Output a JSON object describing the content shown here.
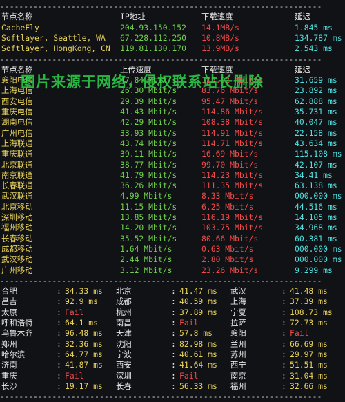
{
  "divider": "--------------------------------------------------------------------",
  "cdn_table": {
    "headers": [
      "节点名称",
      "IP地址",
      "下载速度",
      "延迟"
    ],
    "rows": [
      {
        "name": "CacheFly",
        "ip": "204.93.150.152",
        "speed": "14.1MB/s",
        "latency": "1.845 ms"
      },
      {
        "name": "Softlayer, Seattle, WA",
        "ip": "67.228.112.250",
        "speed": "10.8MB/s",
        "latency": "134.787 ms"
      },
      {
        "name": "Softlayer, HongKong, CN",
        "ip": "119.81.130.170",
        "speed": "13.9MB/s",
        "latency": "2.543 ms"
      }
    ]
  },
  "watermark": "图片来源于网络，侵权联系站长删除",
  "isp_table": {
    "headers": [
      "节点名称",
      "上传速度",
      "下载速度",
      "延迟"
    ],
    "rows": [
      {
        "name": "襄阳电信",
        "up": "47.84 Mbit/s",
        "down": "115.02 Mbit/s",
        "latency": "31.659 ms"
      },
      {
        "name": "上海电信",
        "up": "26.30 Mbit/s",
        "down": "83.76 Mbit/s",
        "latency": "23.892 ms"
      },
      {
        "name": "西安电信",
        "up": "29.39 Mbit/s",
        "down": "95.47 Mbit/s",
        "latency": "62.888 ms"
      },
      {
        "name": "重庆电信",
        "up": "41.43 Mbit/s",
        "down": "114.86 Mbit/s",
        "latency": "35.731 ms"
      },
      {
        "name": "湖南电信",
        "up": "42.29 Mbit/s",
        "down": "108.38 Mbit/s",
        "latency": "40.047 ms"
      },
      {
        "name": "广州电信",
        "up": "33.93 Mbit/s",
        "down": "114.91 Mbit/s",
        "latency": "22.158 ms"
      },
      {
        "name": "上海联通",
        "up": "43.74 Mbit/s",
        "down": "114.71 Mbit/s",
        "latency": "43.634 ms"
      },
      {
        "name": "重庆联通",
        "up": "39.11 Mbit/s",
        "down": "16.69 Mbit/s",
        "latency": "115.108 ms"
      },
      {
        "name": "北京联通",
        "up": "38.77 Mbit/s",
        "down": "99.70 Mbit/s",
        "latency": "42.107 ms"
      },
      {
        "name": "南京联通",
        "up": "41.79 Mbit/s",
        "down": "114.23 Mbit/s",
        "latency": "34.41 ms"
      },
      {
        "name": "长春联通",
        "up": "36.26 Mbit/s",
        "down": "111.35 Mbit/s",
        "latency": "63.138 ms"
      },
      {
        "name": "武汉联通",
        "up": "4.99 Mbit/s",
        "down": "8.33 Mbit/s",
        "latency": "000.000 ms"
      },
      {
        "name": "北京移动",
        "up": "11.15 Mbit/s",
        "down": "6.25 Mbit/s",
        "latency": "44.516 ms"
      },
      {
        "name": "深圳移动",
        "up": "13.85 Mbit/s",
        "down": "116.19 Mbit/s",
        "latency": "14.105 ms"
      },
      {
        "name": "福州移动",
        "up": "14.20 Mbit/s",
        "down": "103.75 Mbit/s",
        "latency": "34.968 ms"
      },
      {
        "name": "长春移动",
        "up": "35.52 Mbit/s",
        "down": "80.66 Mbit/s",
        "latency": "60.381 ms"
      },
      {
        "name": "成都移动",
        "up": "1.64 Mbit/s",
        "down": "0.63 Mbit/s",
        "latency": "000.000 ms"
      },
      {
        "name": "武汉移动",
        "up": "2.44 Mbit/s",
        "down": "2.80 Mbit/s",
        "latency": "000.000 ms"
      },
      {
        "name": "广州移动",
        "up": "3.12 Mbit/s",
        "down": "23.26 Mbit/s",
        "latency": "9.299 ms"
      }
    ]
  },
  "ping_grid": {
    "rows": [
      [
        {
          "city": "合肥",
          "val": "34.33 ms",
          "status": "ok"
        },
        {
          "city": "北京",
          "val": "41.47 ms",
          "status": "ok"
        },
        {
          "city": "武汉",
          "val": "41.48 ms",
          "status": "ok"
        }
      ],
      [
        {
          "city": "昌吉",
          "val": "92.9 ms",
          "status": "ok"
        },
        {
          "city": "成都",
          "val": "40.59 ms",
          "status": "ok"
        },
        {
          "city": "上海",
          "val": "37.39 ms",
          "status": "ok"
        }
      ],
      [
        {
          "city": "太原",
          "val": "Fail",
          "status": "fail"
        },
        {
          "city": "杭州",
          "val": "37.89 ms",
          "status": "ok"
        },
        {
          "city": "宁夏",
          "val": "108.73 ms",
          "status": "ok"
        }
      ],
      [
        {
          "city": "呼和浩特",
          "val": "64.1 ms",
          "status": "ok"
        },
        {
          "city": "南昌",
          "val": "Fail",
          "status": "fail"
        },
        {
          "city": "拉萨",
          "val": "72.73 ms",
          "status": "ok"
        }
      ],
      [
        {
          "city": "乌鲁木齐",
          "val": "96.48 ms",
          "status": "ok"
        },
        {
          "city": "天津",
          "val": "57.8 ms",
          "status": "ok"
        },
        {
          "city": "襄阳",
          "val": "Fail",
          "status": "fail"
        }
      ],
      [
        {
          "city": "郑州",
          "val": "32.36 ms",
          "status": "ok"
        },
        {
          "city": "沈阳",
          "val": "82.98 ms",
          "status": "ok"
        },
        {
          "city": "兰州",
          "val": "66.69 ms",
          "status": "ok"
        }
      ],
      [
        {
          "city": "哈尔滨",
          "val": "64.77 ms",
          "status": "ok"
        },
        {
          "city": "宁波",
          "val": "40.61 ms",
          "status": "ok"
        },
        {
          "city": "苏州",
          "val": "29.97 ms",
          "status": "ok"
        }
      ],
      [
        {
          "city": "济南",
          "val": "41.87 ms",
          "status": "ok"
        },
        {
          "city": "西安",
          "val": "41.64 ms",
          "status": "ok"
        },
        {
          "city": "西宁",
          "val": "51.51 ms",
          "status": "ok"
        }
      ],
      [
        {
          "city": "重庆",
          "val": "Fail",
          "status": "fail"
        },
        {
          "city": "深圳",
          "val": "Fail",
          "status": "fail"
        },
        {
          "city": "南京",
          "val": "31.04 ms",
          "status": "ok"
        }
      ],
      [
        {
          "city": "长沙",
          "val": "19.17 ms",
          "status": "ok"
        },
        {
          "city": "长春",
          "val": "56.33 ms",
          "status": "ok"
        },
        {
          "city": "福州",
          "val": "32.66 ms",
          "status": "ok"
        }
      ]
    ]
  },
  "colors": {
    "background": "#111216",
    "header": "#e6e6e6",
    "name": "#e8d25a",
    "ip": "#6fd14b",
    "speed": "#f04a4a",
    "latency": "#4fe0e0",
    "watermark": "#2fd34b"
  }
}
